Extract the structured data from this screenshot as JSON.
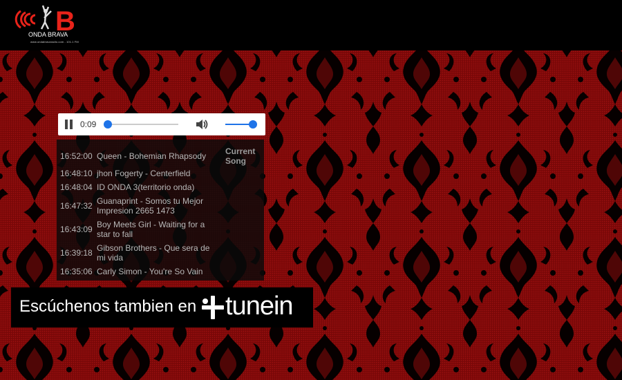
{
  "header": {
    "logo_text": "ONDA BRAVA",
    "logo_subtext": "www.ondabravaradio.com - 101.1 FM"
  },
  "player": {
    "time": "0:09",
    "progress": 0.0,
    "volume": 1.0,
    "accent_color": "#1e73e8"
  },
  "playlist": {
    "current_label": "Current Song",
    "rows": [
      {
        "time": "16:52:00",
        "song": "Queen - Bohemian Rhapsody"
      },
      {
        "time": "16:48:10",
        "song": "jhon Fogerty - Centerfield"
      },
      {
        "time": "16:48:04",
        "song": "ID ONDA 3(territorio onda)"
      },
      {
        "time": "16:47:32",
        "song": "Guanaprint - Somos tu Mejor Impresion 2665 1473"
      },
      {
        "time": "16:43:09",
        "song": "Boy Meets Girl - Waiting for a star to fall"
      },
      {
        "time": "16:39:18",
        "song": "Gibson Brothers - Que sera de mi vida"
      },
      {
        "time": "16:35:06",
        "song": "Carly Simon - You're So Vain"
      }
    ]
  },
  "tunein": {
    "text": "Escúchenos tambien en",
    "brand": "tunein"
  },
  "colors": {
    "background_red": "#8a0a0a",
    "pattern_black": "#050000"
  }
}
